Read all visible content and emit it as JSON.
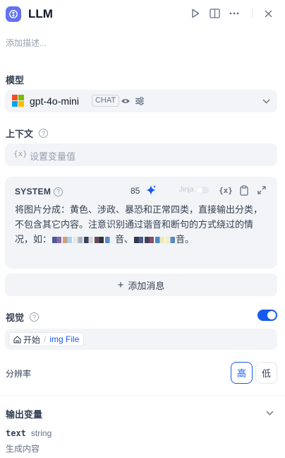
{
  "header": {
    "title": "LLM",
    "icons": [
      "run-icon",
      "split-view-icon",
      "more-icon",
      "close-icon"
    ]
  },
  "description_placeholder": "添加描述...",
  "model_section": {
    "label": "模型",
    "model_name": "gpt-4o-mini",
    "mode_badge": "CHAT"
  },
  "context_section": {
    "label": "上下文",
    "var_icon": "{x}",
    "placeholder": "设置变量值"
  },
  "system_prompt": {
    "role": "SYSTEM",
    "char_count": "85",
    "jinja_label": "Jinja",
    "text_part1": "将图片分成：黄色、涉政、暴恐和正常四类，直接输出分类，不包含其它内容。注意识别通过谐音和断句的方式绕过的情况，如：",
    "text_mid1": "音、",
    "text_end": "音。"
  },
  "add_message": {
    "plus": "+",
    "label": "添加消息"
  },
  "vision": {
    "label": "视觉",
    "enabled": true,
    "file_source": "开始",
    "file_separator": "/",
    "file_var": "img File"
  },
  "resolution": {
    "label": "分辨率",
    "options": [
      "高",
      "低"
    ],
    "selected": "高"
  },
  "output": {
    "title": "输出变量",
    "var_name": "text",
    "var_type": "string",
    "var_desc": "生成内容"
  },
  "colors": {
    "accent": "#155aef",
    "node_icon": "#6172f3",
    "field_bg": "#f2f4f7"
  }
}
